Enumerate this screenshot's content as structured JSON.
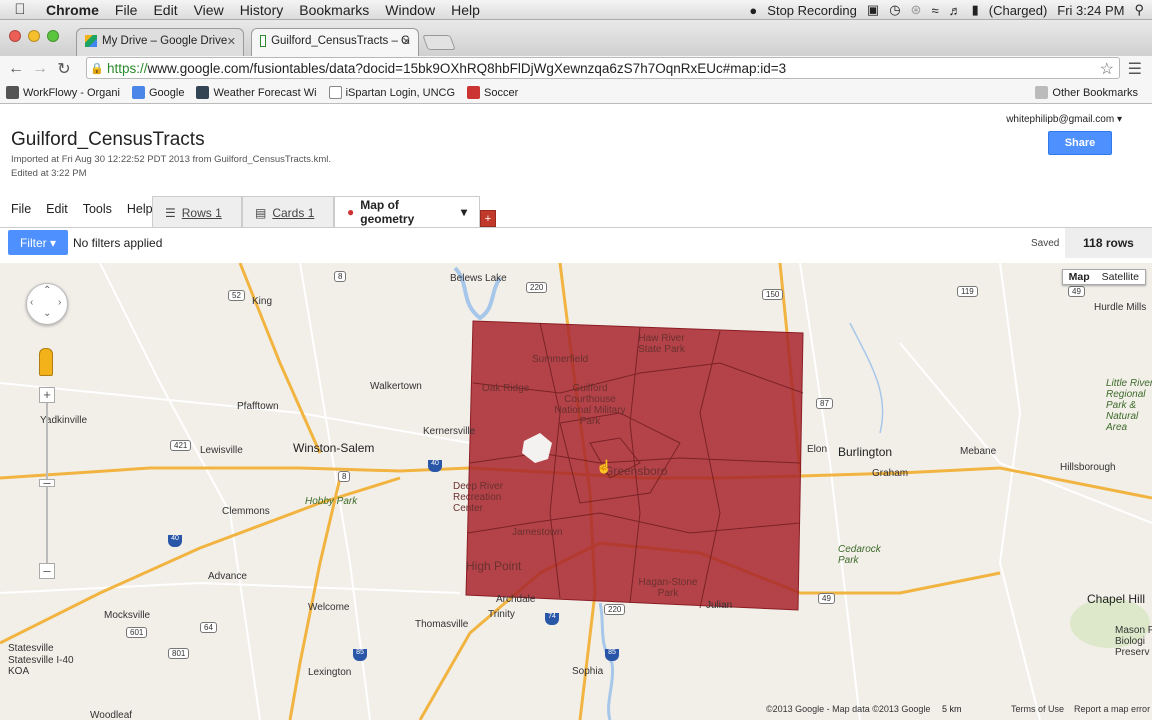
{
  "menubar": {
    "app": "Chrome",
    "items": [
      "File",
      "Edit",
      "View",
      "History",
      "Bookmarks",
      "Window",
      "Help"
    ],
    "recording": "Stop Recording",
    "battery": "(Charged)",
    "clock": "Fri 3:24 PM"
  },
  "tabs": [
    {
      "title": "My Drive – Google Drive"
    },
    {
      "title": "Guilford_CensusTracts – G"
    }
  ],
  "address": {
    "scheme": "https://",
    "url": "www.google.com/fusiontables/data?docid=15bk9OXhRQ8hbFlDjWgXewnzqa6zS7h7OqnRxEUc#map:id=3"
  },
  "bookmarks": [
    "WorkFlowy - Organi",
    "Google",
    "Weather Forecast Wi",
    "iSpartan Login, UNCG",
    "Soccer"
  ],
  "other_bookmarks": "Other Bookmarks",
  "header": {
    "title": "Guilford_CensusTracts",
    "imported": "Imported at Fri Aug 30 12:22:52 PDT 2013 from Guilford_CensusTracts.kml.",
    "edited": "Edited at 3:22 PM",
    "user": "whitephilipb@gmail.com",
    "share": "Share"
  },
  "app_menu": [
    "File",
    "Edit",
    "Tools",
    "Help"
  ],
  "view_tabs": [
    {
      "label": "Rows 1"
    },
    {
      "label": "Cards 1"
    },
    {
      "label": "Map of geometry"
    }
  ],
  "add_tab": "+",
  "filter": {
    "button": "Filter",
    "status": "No filters applied",
    "saved": "Saved",
    "rows": "118 rows"
  },
  "map": {
    "map_type": [
      "Map",
      "Satellite"
    ],
    "places": {
      "king": "King",
      "walkertown": "Walkertown",
      "pfafftown": "Pfafftown",
      "yadkinville": "Yadkinville",
      "lewisville": "Lewisville",
      "winston_salem": "Winston-Salem",
      "kernersville": "Kernersville",
      "clemmons": "Clemmons",
      "hobby_park": "Hobby Park",
      "advance": "Advance",
      "mocksville": "Mocksville",
      "welcome": "Welcome",
      "thomasville": "Thomasville",
      "lexington": "Lexington",
      "sophia": "Sophia",
      "statesville": "Statesville",
      "statesville_koa": "Statesville I-40 KOA",
      "belews_lake": "Belews Lake",
      "hurdle_mills": "Hurdle Mills",
      "little_river": "Little River Regional Park & Natural Area",
      "burlington": "Burlington",
      "elon": "Elon",
      "graham": "Graham",
      "mebane": "Mebane",
      "hillsborough": "Hillsborough",
      "cedarock": "Cedarock Park",
      "chapel_hill": "Chapel Hill",
      "mason_farm": "Mason F Biologi Preserv",
      "woodleaf": "Woodleaf",
      "julian": "Julian",
      "trinity": "Trinity",
      "archdale": "Archdale",
      "summerfield": "Summerfield",
      "haw_river": "Haw River State Park",
      "oak_ridge": "Oak Ridge",
      "guilford_courthouse": "Guilford Courthouse National Military Park",
      "greensboro": "Greensboro",
      "deep_river": "Deep River Recreation Center",
      "jamestown": "Jamestown",
      "high_point": "High Point",
      "hagan_stone": "Hagan-Stone Park"
    },
    "routes": [
      "8",
      "52",
      "220",
      "150",
      "119",
      "49",
      "87",
      "421",
      "40",
      "8",
      "74",
      "85",
      "601",
      "64",
      "801",
      "49",
      "220",
      "85",
      "40"
    ],
    "copyright": "©2013 Google - Map data ©2013 Google",
    "scale": "5 km",
    "terms": "Terms of Use",
    "report": "Report a map error",
    "colors": {
      "polygon": "#a8242c",
      "highway": "#f2b441",
      "water": "#a7c7ea",
      "park": "#cfe3b6"
    }
  }
}
